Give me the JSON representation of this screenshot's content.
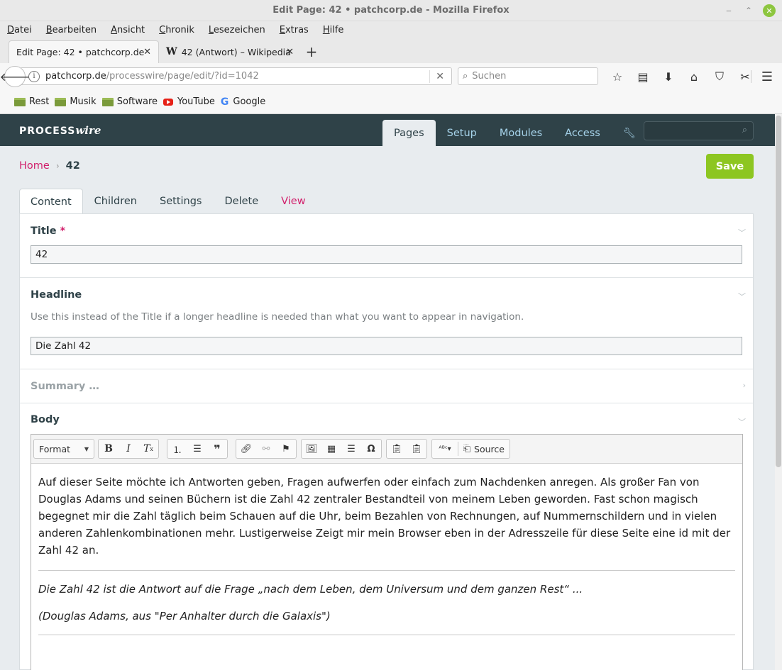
{
  "window": {
    "title": "Edit Page: 42 • patchcorp.de - Mozilla Firefox"
  },
  "menu": [
    "Datei",
    "Bearbeiten",
    "Ansicht",
    "Chronik",
    "Lesezeichen",
    "Extras",
    "Hilfe"
  ],
  "tabs": [
    {
      "label": "Edit Page: 42 • patchcorp.de",
      "active": true
    },
    {
      "label": "42 (Antwort) – Wikipedia",
      "active": false,
      "favicon": "W"
    }
  ],
  "nav": {
    "url_host": "patchcorp.de",
    "url_path": "/processwire/page/edit/?id=1042",
    "search_placeholder": "Suchen"
  },
  "bookmarks": [
    {
      "label": "Rest",
      "icon": "folder-icon"
    },
    {
      "label": "Musik",
      "icon": "folder-icon"
    },
    {
      "label": "Software",
      "icon": "folder-icon"
    },
    {
      "label": "YouTube",
      "icon": "youtube-icon"
    },
    {
      "label": "Google",
      "icon": "google-icon"
    }
  ],
  "pw": {
    "logo_main": "PROCESS",
    "logo_italic": "wire",
    "nav": [
      "Pages",
      "Setup",
      "Modules",
      "Access"
    ],
    "active_nav": "Pages"
  },
  "breadcrumb": {
    "home": "Home",
    "current": "42"
  },
  "save_label": "Save",
  "edit_tabs": [
    "Content",
    "Children",
    "Settings",
    "Delete",
    "View"
  ],
  "fields": {
    "title": {
      "label": "Title",
      "required_mark": "*",
      "value": "42"
    },
    "headline": {
      "label": "Headline",
      "description": "Use this instead of the Title if a longer headline is needed than what you want to appear in navigation.",
      "value": "Die Zahl 42"
    },
    "summary": {
      "label": "Summary …"
    },
    "body": {
      "label": "Body",
      "format_label": "Format",
      "source_label": "Source",
      "paragraphs": [
        "Auf dieser Seite möchte ich Antworten geben, Fragen aufwerfen oder einfach zum Nachdenken anregen. Als großer Fan von Douglas Adams und seinen Büchern ist die Zahl 42 zentraler Bestandteil von meinem Leben geworden. Fast schon magisch begegnet mir die Zahl täglich beim Schauen auf die Uhr, beim Bezahlen von Rechnungen, auf Nummernschildern und in vielen anderen Zahlenkombinationen mehr. Lustigerweise Zeigt mir mein Browser eben in der Adresszeile für diese Seite eine id mit der Zahl 42 an."
      ],
      "quote": "Die Zahl 42 ist die Antwort auf die Frage „nach dem Leben, dem Universum und dem ganzen Rest“ ...",
      "citation": "(Douglas Adams, aus \"Per Anhalter durch die Galaxis\")"
    }
  },
  "colors": {
    "pw_header": "#2f4248",
    "accent_pink": "#d11f6b",
    "save_green": "#8dc621",
    "nav_link": "#a6d3ea"
  }
}
